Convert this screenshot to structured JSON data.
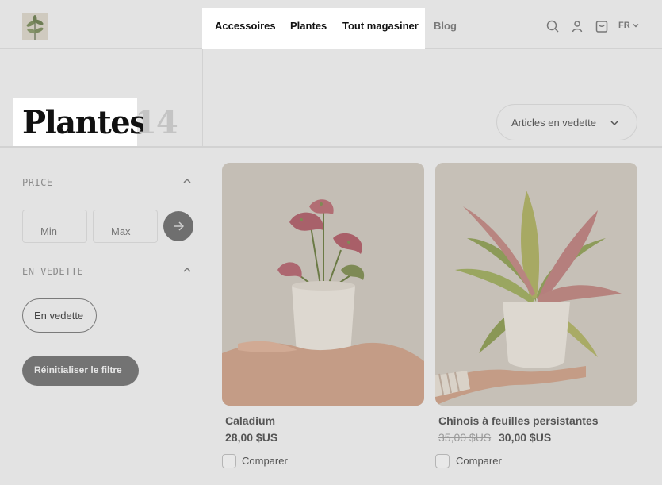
{
  "header": {
    "logo_icon": "plant-logo-icon",
    "nav": [
      {
        "label": "Accessoires"
      },
      {
        "label": "Plantes"
      },
      {
        "label": "Tout magasiner"
      },
      {
        "label": "Blog"
      }
    ],
    "icons": [
      "search-icon",
      "account-icon",
      "cart-icon"
    ],
    "language": "FR"
  },
  "page": {
    "title": "Plantes",
    "count": "14",
    "sort_label": "Articles en vedette"
  },
  "filters": {
    "price": {
      "heading": "PRICE",
      "min_placeholder": "Min",
      "max_placeholder": "Max"
    },
    "featured": {
      "heading": "EN VEDETTE",
      "chip_label": "En vedette"
    },
    "reset_label": "Réinitialiser le filtre"
  },
  "products": [
    {
      "name": "Caladium",
      "price": "28,00 $US",
      "compare_label": "Comparer"
    },
    {
      "name": "Chinois à feuilles persistantes",
      "old_price": "35,00 $US",
      "price": "30,00 $US",
      "compare_label": "Comparer"
    }
  ],
  "colors": {
    "background": "#e3e3e3",
    "highlight": "#ffffff",
    "button_dark": "#737373"
  }
}
